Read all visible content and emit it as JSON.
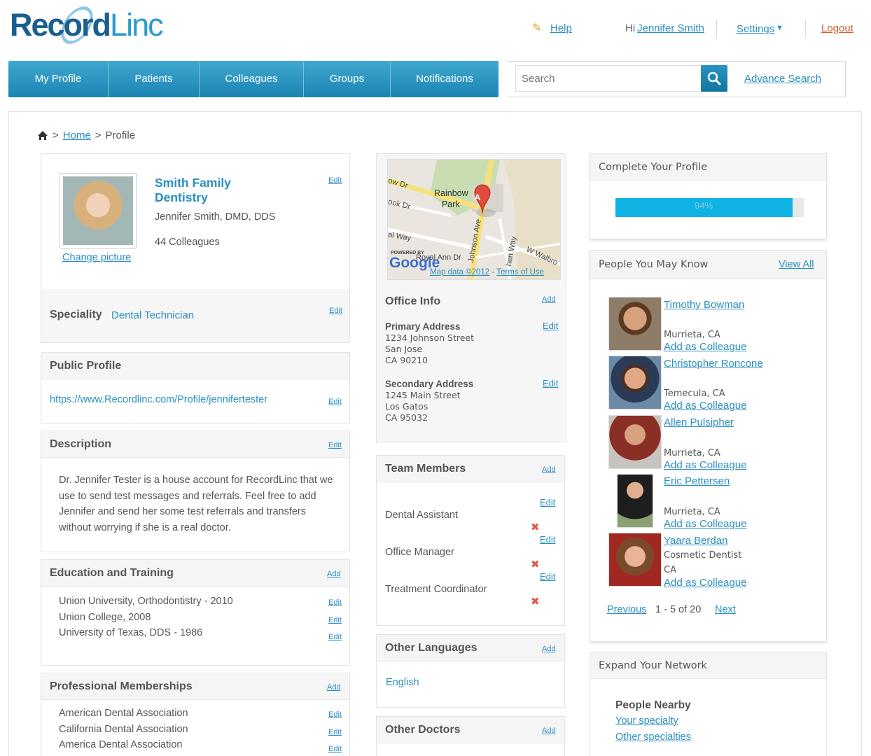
{
  "brand": {
    "logo_part1": "Record",
    "logo_part2": "Linc"
  },
  "header": {
    "help": "Help",
    "greeting": "Hi",
    "user_name": "Jennifer Smith",
    "settings": "Settings",
    "logout": "Logout"
  },
  "nav": {
    "items": [
      "My Profile",
      "Patients",
      "Colleagues",
      "Groups",
      "Notifications"
    ],
    "search_placeholder": "Search",
    "advance_search": "Advance Search"
  },
  "breadcrumb": {
    "sep": ">",
    "home": "Home",
    "current": "Profile"
  },
  "profile": {
    "practice_name_line1": "Smith Family",
    "practice_name_line2": "Dentistry",
    "doctor_name": "Jennifer Smith, DMD, DDS",
    "colleagues": "44 Colleagues",
    "change_picture": "Change picture",
    "edit": "Edit",
    "speciality_label": "Speciality",
    "speciality_value": "Dental Technician"
  },
  "public_profile": {
    "title": "Public Profile",
    "url": "https://www.Recordlinc.com/Profile/jennifertester",
    "edit": "Edit"
  },
  "description": {
    "title": "Description",
    "edit": "Edit",
    "lines": [
      "Dr. Jennifer Tester is a house account for RecordLinc that we",
      "use to send test messages and referrals. Feel free to add",
      "Jennifer and send her some test referrals and transfers",
      "without worrying if she is a real doctor."
    ]
  },
  "education": {
    "title": "Education and Training",
    "add": "Add",
    "edit": "Edit",
    "items": [
      "Union University, Orthodontistry - 2010",
      "Union College, 2008",
      "University of Texas, DDS - 1986"
    ]
  },
  "memberships": {
    "title": "Professional Memberships",
    "add": "Add",
    "edit": "Edit",
    "items": [
      "American Dental Association",
      "California Dental Association",
      "America Dental Association"
    ]
  },
  "map": {
    "labels": {
      "rainbow": "Rainbow",
      "park": "Park",
      "pin": "A",
      "johnson": "Johnson Ave",
      "royal": "Royal Ann Dr",
      "walbro": "W Walbro",
      "way": "al Way",
      "ow_dr": "ow Dr",
      "ook_dr": "ook Dr",
      "hen_way": "hen Way"
    },
    "powered_by": "POWERED BY",
    "google": "Google",
    "map_data": "Map data ©2012",
    "dash": " - ",
    "terms": "Terms of Use"
  },
  "office": {
    "title": "Office Info",
    "add": "Add",
    "edit": "Edit",
    "primary": {
      "label": "Primary Address",
      "lines": [
        "1234 Johnson Street",
        "San Jose",
        "CA   90210"
      ]
    },
    "secondary": {
      "label": "Secondary Address",
      "lines": [
        "1245 Main Street",
        "Los Gatos",
        "CA   95032"
      ]
    }
  },
  "team": {
    "title": "Team Members",
    "add": "Add",
    "edit": "Edit",
    "members": [
      "Dental Assistant",
      "Office Manager",
      "Treatment Coordinator"
    ]
  },
  "languages": {
    "title": "Other Languages",
    "add": "Add",
    "items": [
      "English"
    ]
  },
  "other_doctors": {
    "title": "Other Doctors",
    "add": "Add"
  },
  "complete_profile": {
    "title": "Complete Your Profile",
    "percent": 94,
    "percent_label": "94%"
  },
  "people": {
    "title": "People You May Know",
    "view_all": "View All",
    "add_colleague": "Add as Colleague",
    "list": [
      {
        "name": "Timothy Bowman",
        "detail": "",
        "location": "Murrieta, CA"
      },
      {
        "name": "Christopher Roncone",
        "detail": "",
        "location": "Temecula, CA"
      },
      {
        "name": "Allen Pulsipher",
        "detail": "",
        "location": "Murrieta, CA"
      },
      {
        "name": "Eric Pettersen",
        "detail": "",
        "location": "Murrieta, CA"
      },
      {
        "name": "Yaara Berdan",
        "detail": "Cosmetic Dentist",
        "location": "CA"
      }
    ],
    "previous": "Previous",
    "range": "1 - 5 of 20",
    "next": "Next"
  },
  "network": {
    "title": "Expand Your Network",
    "nearby": "People Nearby",
    "your_specialty": "Your specialty",
    "other_specialties": "Other specialties"
  }
}
